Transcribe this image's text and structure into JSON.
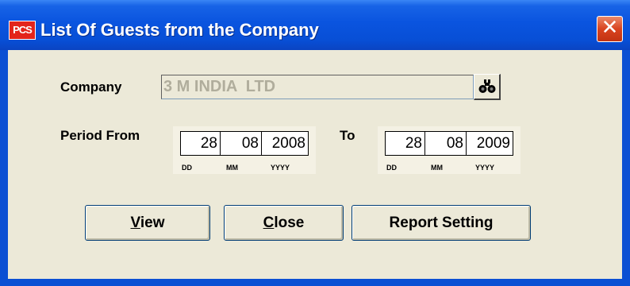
{
  "window": {
    "title": "List Of Guests from the Company",
    "app_icon_text": "PCS",
    "close_glyph": "✕"
  },
  "form": {
    "company_label": "Company",
    "company_value": "3 M INDIA  LTD",
    "search_icon": "binoculars-icon",
    "period_from_label": "Period From",
    "to_label": "To",
    "from_date": {
      "dd": "28",
      "mm": "08",
      "yyyy": "2008"
    },
    "to_date": {
      "dd": "28",
      "mm": "08",
      "yyyy": "2009"
    },
    "date_sublabels": {
      "dd": "DD",
      "mm": "MM",
      "yyyy": "YYYY"
    }
  },
  "buttons": {
    "view": {
      "first": "V",
      "rest": "iew"
    },
    "close": {
      "first": "C",
      "rest": "lose"
    },
    "report_setting": "Report Setting"
  },
  "colors": {
    "title_bar": "#0a54df",
    "dialog_bg": "#ece9d8",
    "close_button": "#d9431f",
    "disabled_text": "#b0ad9c"
  }
}
